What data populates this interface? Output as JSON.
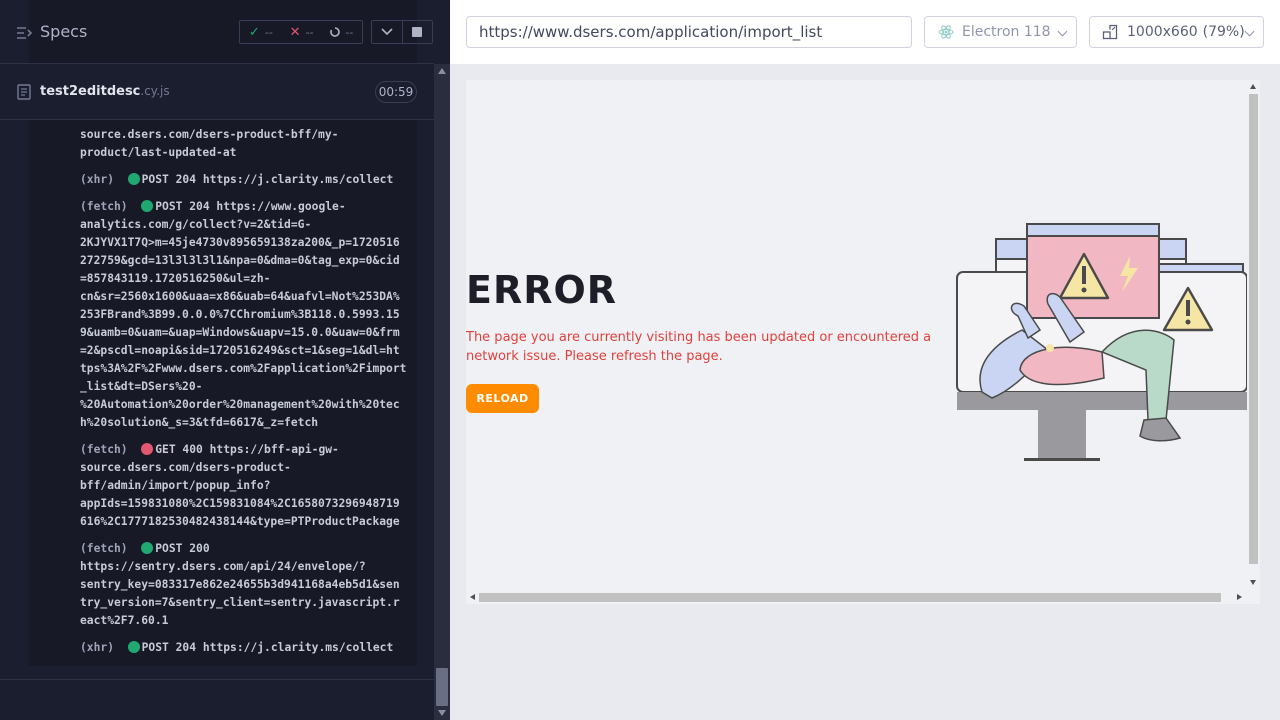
{
  "reporter": {
    "title": "Specs",
    "stats": {
      "passed": "--",
      "failed": "--",
      "pending": "--"
    },
    "spec": {
      "name": "test2editdesc",
      "ext": ".cy.js",
      "timer": "00:59"
    },
    "commands": [
      {
        "lines": [
          "source.dsers.com/dsers-product-bff/my-",
          "product/last-updated-at"
        ]
      },
      {
        "type": "(xhr)",
        "status": "ok",
        "lines": [
          "POST 204 https://j.clarity.ms/collect"
        ]
      },
      {
        "type": "(fetch)",
        "status": "ok",
        "lines": [
          "POST 204 https://www.google-",
          "analytics.com/g/collect?v=2&tid=G-",
          "2KJYVX1T7Q>m=45je4730v895659138za200&_p=1720516",
          "272759&gcd=13l3l3l3l1&npa=0&dma=0&tag_exp=0&cid",
          "=857843119.1720516250&ul=zh-",
          "cn&sr=2560x1600&uaa=x86&uab=64&uafvl=Not%253DA%",
          "253FBrand%3B99.0.0.0%7CChromium%3B118.0.5993.15",
          "9&uamb=0&uam=&uap=Windows&uapv=15.0.0&uaw=0&frm",
          "=2&pscdl=noapi&sid=1720516249&sct=1&seg=1&dl=ht",
          "tps%3A%2F%2Fwww.dsers.com%2Fapplication%2Fimport",
          "_list&dt=DSers%20-",
          "%20Automation%20order%20management%20with%20tec",
          "h%20solution&_s=3&tfd=6617&_z=fetch"
        ]
      },
      {
        "type": "(fetch)",
        "status": "err",
        "lines": [
          "GET 400 https://bff-api-gw-",
          "source.dsers.com/dsers-product-",
          "bff/admin/import/popup_info?",
          "appIds=159831080%2C159831084%2C1658073296948719",
          "616%2C1777182530482438144&type=PTProductPackage"
        ]
      },
      {
        "type": "(fetch)",
        "status": "ok",
        "lines": [
          "POST 200",
          "https://sentry.dsers.com/api/24/envelope/?",
          "sentry_key=083317e862e24655b3d941168a4eb5d1&sen",
          "try_version=7&sentry_client=sentry.javascript.r",
          "eact%2F7.60.1"
        ]
      },
      {
        "type": "(xhr)",
        "status": "ok",
        "lines": [
          "POST 204 https://j.clarity.ms/collect"
        ]
      }
    ]
  },
  "aut": {
    "url": "https://www.dsers.com/application/import_list",
    "browser": "Electron 118",
    "viewport": "1000x660",
    "zoom": "(79%)",
    "page": {
      "title": "ERROR",
      "message": "The page you are currently visiting has been updated or encountered a network issue. Please refresh the page.",
      "button": "RELOAD"
    }
  },
  "colors": {
    "pass": "#1fa971",
    "fail": "#e45770",
    "accent": "#ff8c00",
    "error_text": "#e0413c"
  },
  "icons": [
    "specs-menu-icon",
    "check-icon",
    "x-icon",
    "spinner-icon",
    "chevron-down-icon",
    "stop-icon",
    "file-icon",
    "electron-icon",
    "viewport-icon"
  ]
}
